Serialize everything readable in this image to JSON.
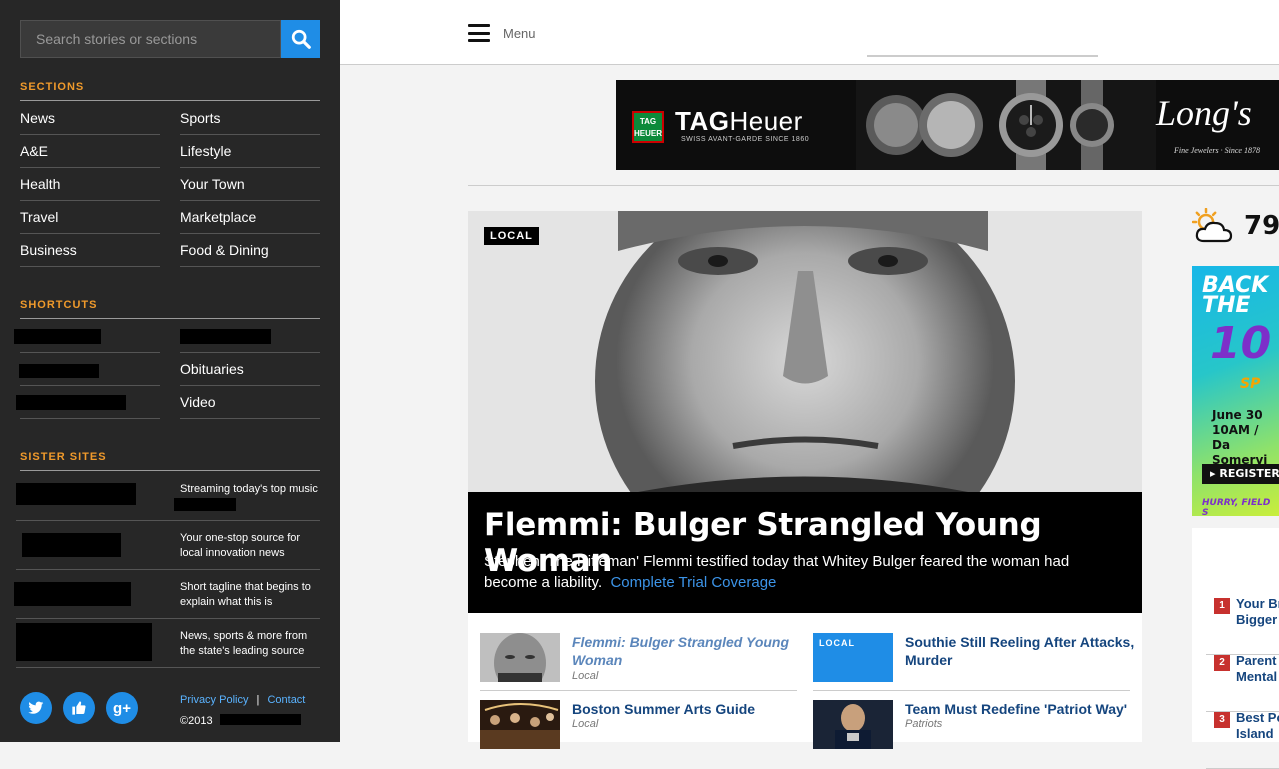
{
  "sidebar": {
    "search": {
      "placeholder": "Search stories or sections"
    },
    "sections_title": "SECTIONS",
    "sections": [
      {
        "label": "News"
      },
      {
        "label": "Sports"
      },
      {
        "label": "A&E"
      },
      {
        "label": "Lifestyle"
      },
      {
        "label": "Health"
      },
      {
        "label": "Your Town"
      },
      {
        "label": "Travel"
      },
      {
        "label": "Marketplace"
      },
      {
        "label": "Business"
      },
      {
        "label": "Food & Dining"
      }
    ],
    "shortcuts_title": "SHORTCUTS",
    "shortcuts": [
      {
        "label": "Obituaries"
      },
      {
        "label": "Video"
      }
    ],
    "sister_title": "SISTER SITES",
    "sister_sites": [
      {
        "desc": "Streaming today's top music & more"
      },
      {
        "desc": "Your one-stop source for local innovation news"
      },
      {
        "desc": "Short tagline that begins to explain what this is"
      },
      {
        "desc": "News, sports & more from the state's leading source"
      }
    ],
    "social": [
      {
        "icon": "twitter-icon",
        "glyph": "t"
      },
      {
        "icon": "facebook-like-icon",
        "glyph": "👍"
      },
      {
        "icon": "google-plus-icon",
        "glyph": "g+"
      }
    ],
    "legal": {
      "privacy": "Privacy Policy",
      "sep": "|",
      "contact": "Contact",
      "copyright": "©2013"
    }
  },
  "header": {
    "menu_label": "Menu"
  },
  "ad": {
    "brand_bold": "TAG",
    "brand_thin": "Heuer",
    "logo_text": "TAG HEUER",
    "tagline": "SWISS AVANT-GARDE SINCE 1860",
    "retailer": "Long's",
    "retailer_sub": "Fine Jewelers  ·  Since 1878"
  },
  "hero": {
    "badge": "LOCAL",
    "title": "Flemmi: Bulger Strangled Young Woman",
    "dek": "Stephen 'The Rifleman' Flemmi testified today that Whitey Bulger feared the woman had become a liability.",
    "link": "Complete Trial Coverage"
  },
  "stories": [
    {
      "title": "Flemmi: Bulger Strangled Young Woman",
      "kicker": "Local",
      "visited": true
    },
    {
      "title": "Southie Still Reeling After Attacks, Murder",
      "kicker": "",
      "badge": "LOCAL"
    },
    {
      "title": "Boston Summer Arts Guide",
      "kicker": "Local"
    },
    {
      "title": "Team Must Redefine 'Patriot Way'",
      "kicker": "Patriots"
    }
  ],
  "weather": {
    "temp": "79°",
    "icon": "partly-cloudy-icon"
  },
  "side_ad": {
    "line1": "BACK",
    "line2": "THE",
    "big": "10",
    "sp": "SP",
    "date1": "June 30",
    "date2": "10AM / Da",
    "date3": "Somervi",
    "register": "REGISTER",
    "hurry": "HURRY, FIELD S"
  },
  "trending": [
    {
      "num": "1",
      "title": "Your Br\nBigger"
    },
    {
      "num": "2",
      "title": "Parent\nMental"
    },
    {
      "num": "3",
      "title": "Best Po\nIsland"
    }
  ],
  "colors": {
    "sidebar_bg": "#272727",
    "accent_orange": "#f09a2b",
    "accent_blue": "#1f8de6",
    "link_navy": "#15457e",
    "badge_red": "#c7312e"
  }
}
